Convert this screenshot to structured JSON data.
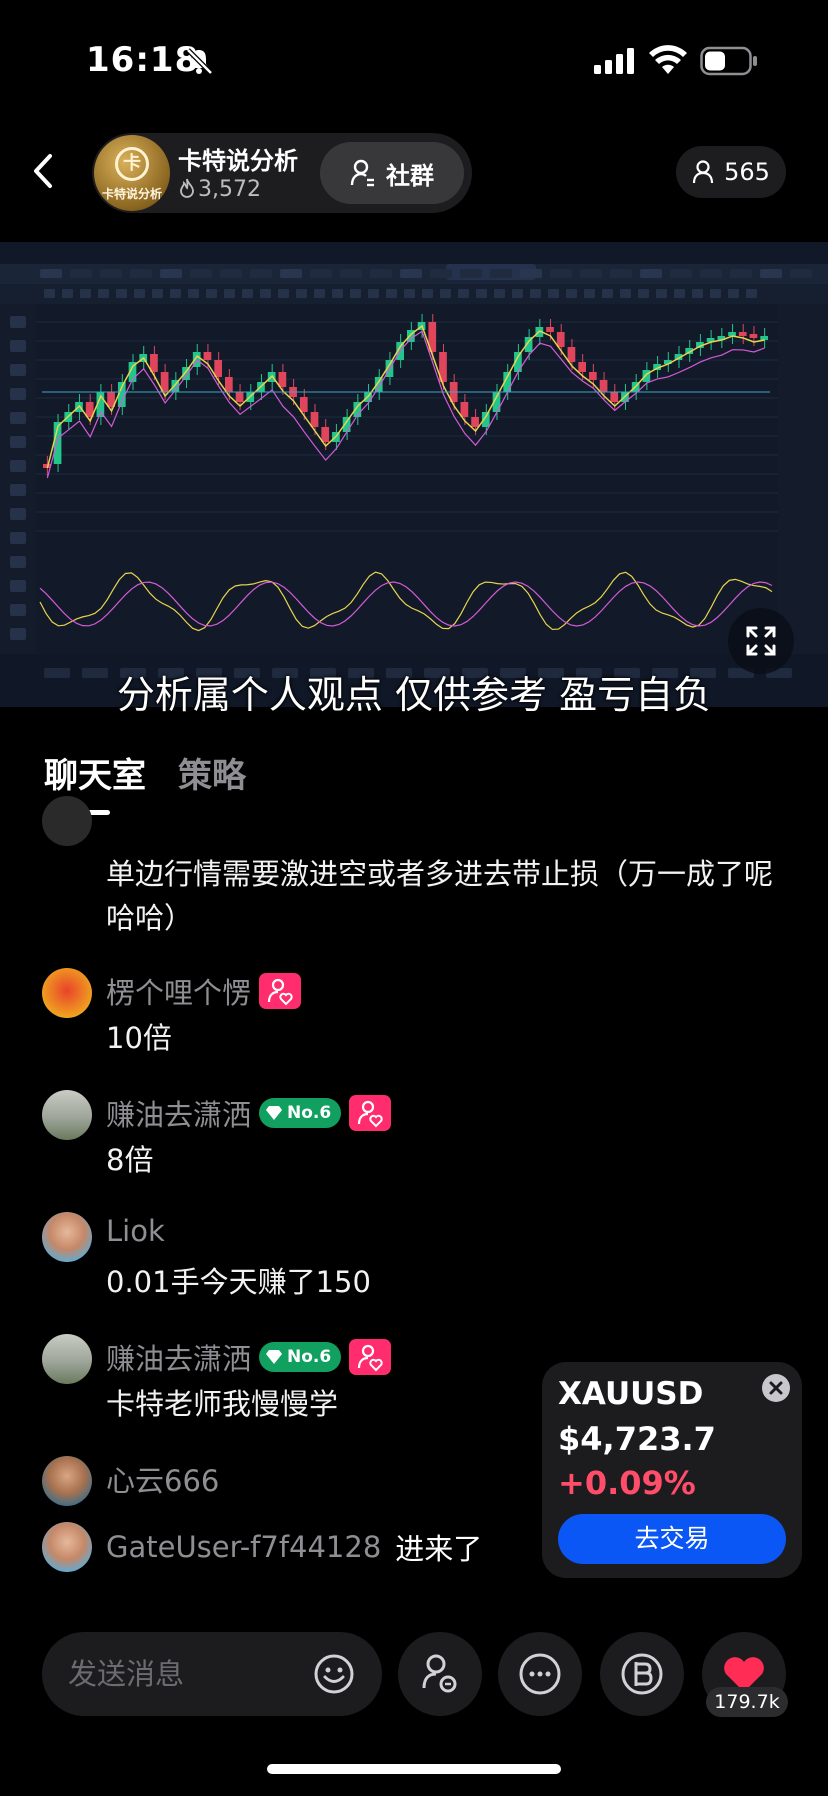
{
  "status_bar": {
    "time": "16:18"
  },
  "header": {
    "host_name": "卡特说分析",
    "host_logo_text": "卡特说分析",
    "host_popularity": "3,572",
    "community_label": "社群",
    "viewer_count": "565"
  },
  "stream": {
    "subtitle": "分析属个人观点 仅供参考 盈亏自负"
  },
  "tabs": {
    "chat": "聊天室",
    "strategy": "策略"
  },
  "chat": {
    "messages": [
      {
        "user": "",
        "text": "单边行情需要激进空或者多进去带止损（万一成了呢哈哈）"
      },
      {
        "user": "楞个哩个愣",
        "text": "10倍"
      },
      {
        "user": "赚油去潇洒",
        "badge": "No.6",
        "text": "8倍"
      },
      {
        "user": "Liok",
        "text": "0.01手今天赚了150"
      },
      {
        "user": "赚油去潇洒",
        "badge": "No.6",
        "text": "卡特老师我慢慢学"
      },
      {
        "user": "心云666",
        "text": ""
      },
      {
        "user": "GateUser-f7f44128",
        "text": "进来了"
      }
    ]
  },
  "ticker": {
    "symbol": "XAUUSD",
    "price": "$4,723.7",
    "change": "+0.09%",
    "trade_label": "去交易",
    "change_color": "#ff4d6a",
    "button_color": "#0a57f5"
  },
  "bottom_bar": {
    "input_placeholder": "发送消息",
    "like_count": "179.7k",
    "like_color": "#ff2d55"
  }
}
